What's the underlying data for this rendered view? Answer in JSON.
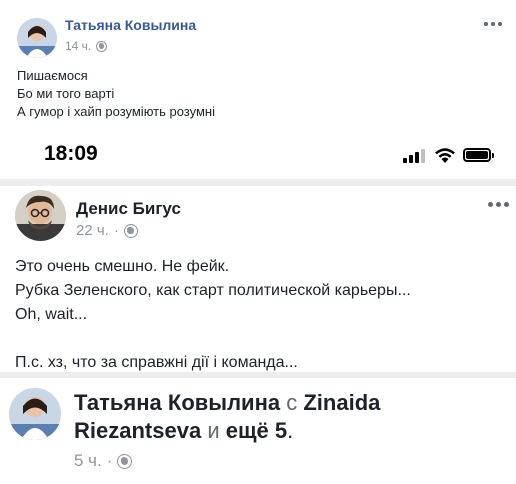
{
  "post": {
    "author": "Татьяна Ковылина",
    "time": "14 ч.",
    "lines": [
      "Пишаємося",
      "Бо ми того варті",
      "А гумор і хайп розуміють розумні"
    ]
  },
  "phone": {
    "time": "18:09"
  },
  "inner_post": {
    "author": "Денис Бигус",
    "time": "22 ч.",
    "lines": [
      "Это очень смешно. Не фейк.",
      "Рубка Зеленского, как старт политической карьеры...",
      "Oh, wait...",
      "",
      "П.с. хз, что за справжні дії і команда..."
    ]
  },
  "third_post": {
    "author": "Татьяна Ковылина",
    "with_word": "с",
    "tagged_first": "Zinaida",
    "tagged_second": "Riezantseva",
    "and_word": "и",
    "others": "ещё 5",
    "period": ".",
    "time": "5 ч."
  },
  "colors": {
    "link": "#385898",
    "meta": "#90949c",
    "text": "#1d2129"
  }
}
